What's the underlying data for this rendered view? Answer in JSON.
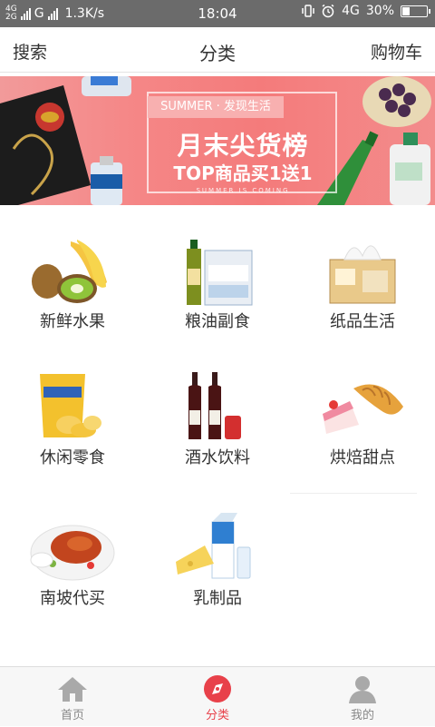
{
  "status_bar": {
    "network_top": "4G",
    "network_bottom": "2G",
    "carrier_g": "G",
    "speed": "1.3K/s",
    "time": "18:04",
    "net_right": "4G",
    "battery": "30%",
    "battery_level": 0.3
  },
  "header": {
    "left": "搜索",
    "title": "分类",
    "right": "购物车"
  },
  "banner": {
    "slogan": "SUMMER · 发现生活",
    "headline": "月末尖货榜",
    "promo": "TOP商品买1送1",
    "tiny": "SUMMER IS COMING",
    "colors": {
      "background": "#f47b7b",
      "text": "#ffffff"
    }
  },
  "categories": [
    {
      "label": "新鲜水果",
      "icon": "fruit-icon"
    },
    {
      "label": "粮油副食",
      "icon": "grain-oil-icon"
    },
    {
      "label": "纸品生活",
      "icon": "tissue-box-icon"
    },
    {
      "label": "休闲零食",
      "icon": "snack-bag-icon"
    },
    {
      "label": "酒水饮料",
      "icon": "wine-bottles-icon"
    },
    {
      "label": "烘焙甜点",
      "icon": "croissant-icon"
    },
    {
      "label": "南坡代买",
      "icon": "roast-chicken-icon"
    },
    {
      "label": "乳制品",
      "icon": "milk-cheese-icon"
    }
  ],
  "bottom_nav": {
    "items": [
      {
        "label": "首页",
        "icon": "home-icon",
        "active": false
      },
      {
        "label": "分类",
        "icon": "compass-icon",
        "active": true
      },
      {
        "label": "我的",
        "icon": "user-icon",
        "active": false
      }
    ],
    "active_color": "#e8414a"
  }
}
